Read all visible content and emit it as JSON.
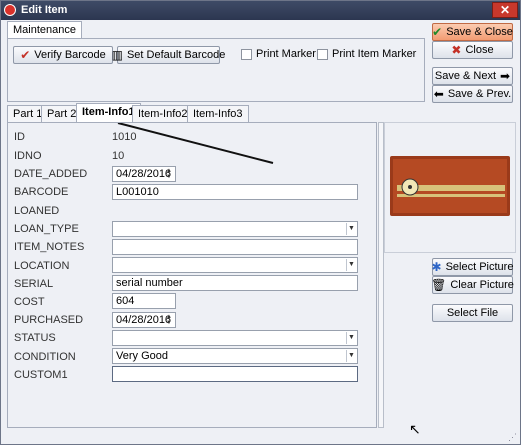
{
  "window": {
    "title": "Edit Item"
  },
  "tabs_top": {
    "maintenance": "Maintenance"
  },
  "buttons": {
    "verify_barcode": "Verify Barcode",
    "set_default_barcode": "Set Default Barcode",
    "save_close": "Save & Close",
    "close": "Close",
    "save_next": "Save & Next",
    "save_prev": "Save & Prev.",
    "select_picture": "Select Picture",
    "clear_picture": "Clear Picture",
    "select_file": "Select File"
  },
  "checkboxes": {
    "print_marker": "Print Marker",
    "print_item_marker": "Print Item Marker"
  },
  "tabs": [
    "Part 1",
    "Part 2",
    "Item-Info1",
    "Item-Info2",
    "Item-Info3"
  ],
  "fields": {
    "id": {
      "label": "ID",
      "value": "1010"
    },
    "idno": {
      "label": "IDNO",
      "value": "10"
    },
    "date_added": {
      "label": "DATE_ADDED",
      "value": "04/28/2016"
    },
    "barcode": {
      "label": "BARCODE",
      "value": "L001010"
    },
    "loaned": {
      "label": "LOANED",
      "value": ""
    },
    "loan_type": {
      "label": "LOAN_TYPE",
      "value": ""
    },
    "item_notes": {
      "label": "ITEM_NOTES",
      "value": ""
    },
    "location": {
      "label": "LOCATION",
      "value": ""
    },
    "serial": {
      "label": "SERIAL",
      "value": "serial number"
    },
    "cost": {
      "label": "COST",
      "value": "604"
    },
    "purchased": {
      "label": "PURCHASED",
      "value": "04/28/2016"
    },
    "status": {
      "label": "STATUS",
      "value": ""
    },
    "condition": {
      "label": "CONDITION",
      "value": "Very Good"
    },
    "custom1": {
      "label": "CUSTOM1",
      "value": ""
    }
  },
  "icons": {
    "app": "record-icon",
    "verify": "checkmark-icon",
    "set_default": "barcode-icon",
    "save_close": "checkmark-icon",
    "close": "x-icon",
    "save_next": "arrow-right-icon",
    "save_prev": "arrow-left-icon",
    "select_picture": "picture-icon",
    "clear_picture": "trash-icon"
  },
  "colors": {
    "accent": "#f39b72",
    "titlebar": "#2c3650"
  }
}
